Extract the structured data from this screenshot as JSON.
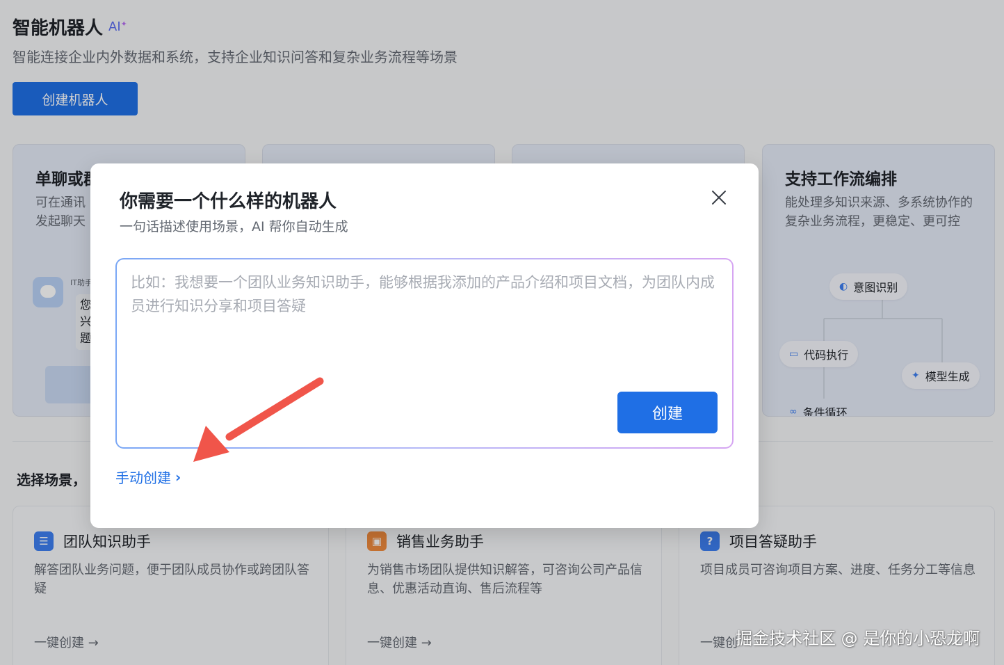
{
  "header": {
    "title": "智能机器人",
    "ai_badge": "AI",
    "subtitle": "智能连接企业内外数据和系统，支持企业知识问答和复杂业务流程等场景",
    "create_button": "创建机器人"
  },
  "feature_cards": [
    {
      "title": "单聊或群",
      "desc": "可在通讯\n发起聊天",
      "it_label": "IT助手",
      "chat_snippet": "您\n兴\n题"
    },
    {
      "title": "支持工作流编排",
      "desc": "能处理多知识来源、多系统协作的复杂业务流程，更稳定、更可控",
      "nodes": [
        "意图识别",
        "代码执行",
        "模型生成",
        "条件循环"
      ]
    }
  ],
  "section": {
    "label": "选择场景，"
  },
  "scene_cards": [
    {
      "title": "团队知识助手",
      "desc": "解答团队业务问题，便于团队成员协作或跨团队答疑",
      "link": "一键创建 →",
      "icon_color": "#3d7ef0"
    },
    {
      "title": "销售业务助手",
      "desc": "为销售市场团队提供知识解答，可咨询公司产品信息、优惠活动直询、售后流程等",
      "link": "一键创建 →",
      "icon_color": "#f08a3d"
    },
    {
      "title": "项目答疑助手",
      "desc": "项目成员可咨询项目方案、进度、任务分工等信息",
      "link": "一键创",
      "icon_color": "#3d7ef0"
    }
  ],
  "modal": {
    "title": "你需要一个什么样的机器人",
    "subtitle": "一句话描述使用场景，AI 帮你自动生成",
    "placeholder": "比如：我想要一个团队业务知识助手，能够根据我添加的产品介绍和项目文档，为团队内成员进行知识分享和项目答疑",
    "create_button": "创建",
    "manual_link": "手动创建"
  },
  "watermark": "掘金技术社区 @ 是你的小恐龙啊",
  "colors": {
    "primary": "#1f6fe5",
    "annotation_arrow": "#f0554a"
  }
}
